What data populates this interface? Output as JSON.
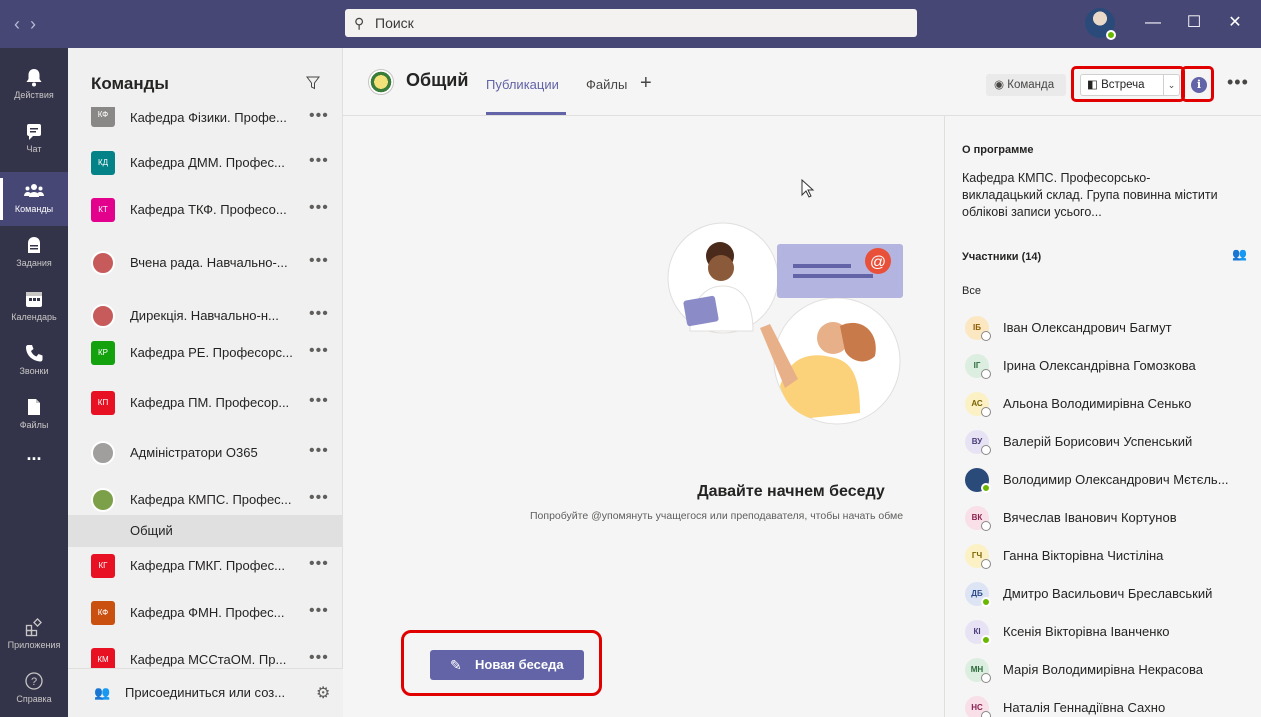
{
  "titlebar": {
    "search_placeholder": "Поиск",
    "nav_back": "‹",
    "nav_forward": "›"
  },
  "rail": {
    "items": [
      {
        "label": "Действия",
        "icon": "bell-icon"
      },
      {
        "label": "Чат",
        "icon": "chat-icon"
      },
      {
        "label": "Команды",
        "icon": "teams-icon"
      },
      {
        "label": "Задания",
        "icon": "assignments-icon"
      },
      {
        "label": "Календарь",
        "icon": "calendar-icon"
      },
      {
        "label": "Звонки",
        "icon": "phone-icon"
      },
      {
        "label": "Файлы",
        "icon": "file-icon"
      },
      {
        "label": "Приложения",
        "icon": "apps-icon"
      },
      {
        "label": "Справка",
        "icon": "help-icon"
      }
    ],
    "more": "..."
  },
  "teams_panel": {
    "title": "Команды",
    "teams": [
      {
        "abbr": "КФ",
        "name": "Кафедра Фізики. Профе...",
        "color": "#8a8886"
      },
      {
        "abbr": "КД",
        "name": "Кафедра ДММ. Профес...",
        "color": "#038387"
      },
      {
        "abbr": "КТ",
        "name": "Кафедра ТКФ. Професо...",
        "color": "#e3008c"
      },
      {
        "abbr": "",
        "name": "Вчена рада. Навчально-...",
        "color": "#c75b5b"
      },
      {
        "abbr": "",
        "name": "Дирекція. Навчально-н...",
        "color": "#c75b5b"
      },
      {
        "abbr": "КР",
        "name": "Кафедра РЕ. Професорс...",
        "color": "#13a10e"
      },
      {
        "abbr": "КП",
        "name": "Кафедра ПМ. Професор...",
        "color": "#e81123"
      },
      {
        "abbr": "",
        "name": "Адміністратори O365",
        "color": "#a19f9d"
      },
      {
        "abbr": "",
        "name": "Кафедра КМПС. Профес...",
        "color": "#7ca04a"
      },
      {
        "abbr": "КГ",
        "name": "Кафедра ГМКГ. Профес...",
        "color": "#e81123"
      },
      {
        "abbr": "КФ",
        "name": "Кафедра ФМН. Профес...",
        "color": "#ca5010"
      },
      {
        "abbr": "КМ",
        "name": "Кафедра МССтаОМ. Пр...",
        "color": "#e81123"
      }
    ],
    "more": "•••",
    "selected_channel": "Общий",
    "join_label": "Присоединиться или соз..."
  },
  "channel": {
    "title": "Общий",
    "tabs": [
      "Публикации",
      "Файлы"
    ],
    "add_tab": "+",
    "team_button": "Команда",
    "meet_button": "Встреча",
    "info": "i",
    "more": "•••"
  },
  "main": {
    "title": "Давайте начнем беседу",
    "subtitle": "Попробуйте @упомянуть учащегося или преподавателя, чтобы начать обме",
    "new_conversation": "Новая беседа"
  },
  "details": {
    "about_header": "О программе",
    "about_text": "Кафедра КМПС. Професорсько-викладацький склад. Група повинна містити облікові записи усього...",
    "members_header": "Участники (14)",
    "all_label": "Все",
    "members": [
      {
        "initials": "ІБ",
        "name": "Іван Олександрович Багмут",
        "bg": "#fbe8c2",
        "fg": "#8a5a00",
        "online": false
      },
      {
        "initials": "ІГ",
        "name": "Ірина Олександрівна Гомозкова",
        "bg": "#dceedf",
        "fg": "#2a6b3a",
        "online": false
      },
      {
        "initials": "АС",
        "name": "Альона Володимирівна Сенько",
        "bg": "#fbf1c4",
        "fg": "#7a6200",
        "online": false
      },
      {
        "initials": "ВУ",
        "name": "Валерій Борисович Успенський",
        "bg": "#e8e3f4",
        "fg": "#4a3b7a",
        "online": false
      },
      {
        "initials": "",
        "name": "Володимир Олександрович Мєтєль...",
        "bg": "#2a4a7a",
        "fg": "#ffffff",
        "online": true
      },
      {
        "initials": "ВК",
        "name": "Вячеслав Іванович Кортунов",
        "bg": "#f8dfe8",
        "fg": "#8a2250",
        "online": false
      },
      {
        "initials": "ГЧ",
        "name": "Ганна Вікторівна Чистіліна",
        "bg": "#fbf1c4",
        "fg": "#7a6200",
        "online": false
      },
      {
        "initials": "ДБ",
        "name": "Дмитро Васильович Бреславський",
        "bg": "#dde4f4",
        "fg": "#2b4a8a",
        "online": true
      },
      {
        "initials": "КІ",
        "name": "Ксенія Вікторівна Іванченко",
        "bg": "#e8e3f4",
        "fg": "#4a3b7a",
        "online": true
      },
      {
        "initials": "МН",
        "name": "Марія Володимирівна Некрасова",
        "bg": "#dceedf",
        "fg": "#2a6b3a",
        "online": false
      },
      {
        "initials": "НС",
        "name": "Наталія Геннадіївна Сахно",
        "bg": "#f8dfe8",
        "fg": "#8a2250",
        "online": false
      }
    ]
  },
  "colors": {
    "accent": "#6264a7",
    "titlebar": "#464775",
    "rail": "#33344a",
    "highlight": "#e00000"
  }
}
